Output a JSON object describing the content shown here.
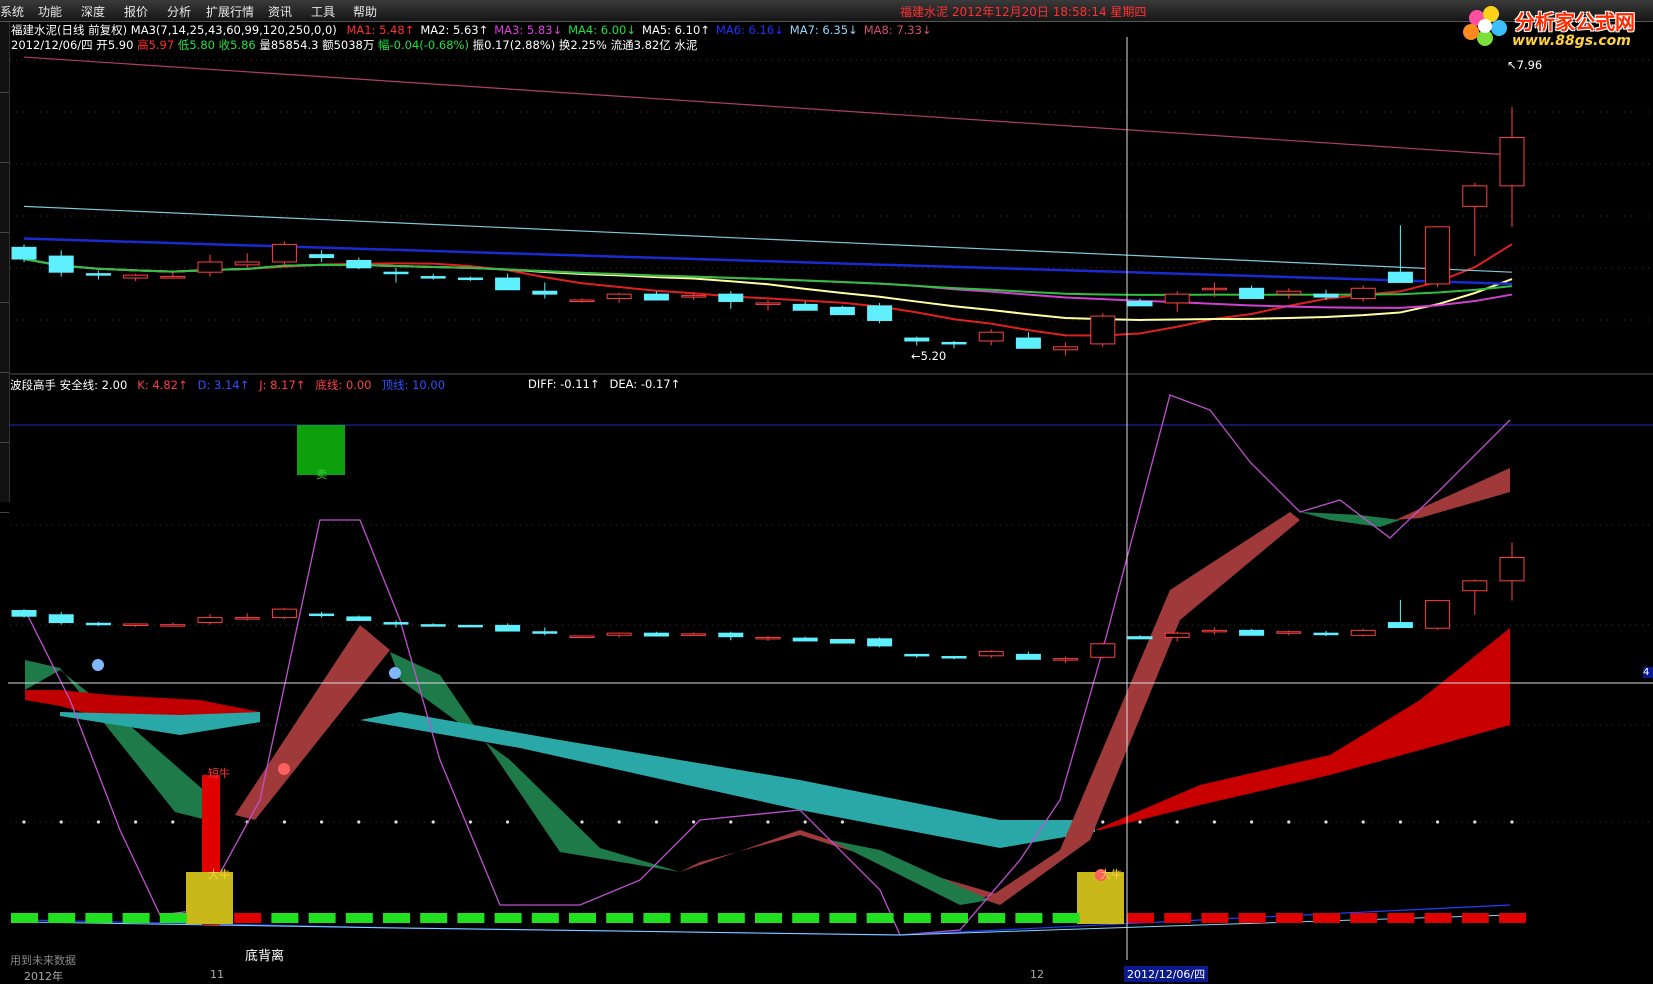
{
  "menu": [
    "系统",
    "功能",
    "深度",
    "报价",
    "分析",
    "扩展行情",
    "资讯",
    "工具",
    "帮助"
  ],
  "window_title": "福建水泥  2012年12月20日  18:58:14  星期四",
  "logo": {
    "title": "分析家公式网",
    "url": "www.88gs.com"
  },
  "header": {
    "stock": "福建水泥(日线 前复权)",
    "ma_params": "MA3(7,14,25,43,60,99,120,250,0,0)",
    "ma": [
      {
        "label": "MA1:",
        "value": "5.48",
        "arrow": "↑",
        "color": "#ff3030"
      },
      {
        "label": "MA2:",
        "value": "5.63",
        "arrow": "↑",
        "color": "#ffffff"
      },
      {
        "label": "MA3:",
        "value": "5.83",
        "arrow": "↓",
        "color": "#e040e0"
      },
      {
        "label": "MA4:",
        "value": "6.00",
        "arrow": "↓",
        "color": "#20e040"
      },
      {
        "label": "MA5:",
        "value": "6.10",
        "arrow": "↑",
        "color": "#ffffff"
      },
      {
        "label": "MA6:",
        "value": "6.16",
        "arrow": "↓",
        "color": "#2030ff"
      },
      {
        "label": "MA7:",
        "value": "6.35",
        "arrow": "↓",
        "color": "#8fd8ff"
      },
      {
        "label": "MA8:",
        "value": "7.33",
        "arrow": "↓",
        "color": "#d05070"
      }
    ],
    "bar_info": [
      {
        "t": "2012/12/06/四 开",
        "c": "#ffffff"
      },
      {
        "t": "5.90 ",
        "c": "#ffffff"
      },
      {
        "t": "高",
        "c": "#ff3030"
      },
      {
        "t": "5.97 ",
        "c": "#ff3030"
      },
      {
        "t": "低",
        "c": "#20e040"
      },
      {
        "t": "5.80 ",
        "c": "#20e040"
      },
      {
        "t": "收",
        "c": "#20e040"
      },
      {
        "t": "5.86 ",
        "c": "#20e040"
      },
      {
        "t": "量",
        "c": "#ffffff"
      },
      {
        "t": "85854.3 ",
        "c": "#ffffff"
      },
      {
        "t": "额",
        "c": "#ffffff"
      },
      {
        "t": "5038万 ",
        "c": "#ffffff"
      },
      {
        "t": "幅",
        "c": "#20e040"
      },
      {
        "t": "-0.04(-0.68%) ",
        "c": "#20e040"
      },
      {
        "t": "振",
        "c": "#ffffff"
      },
      {
        "t": "0.17(2.88%) ",
        "c": "#ffffff"
      },
      {
        "t": "换",
        "c": "#ffffff"
      },
      {
        "t": "2.25% ",
        "c": "#ffffff"
      },
      {
        "t": "流通",
        "c": "#ffffff"
      },
      {
        "t": "3.82亿 ",
        "c": "#ffffff"
      },
      {
        "t": "水泥",
        "c": "#ffffff"
      }
    ]
  },
  "indicator_header": [
    {
      "t": "波段高手  安全线: 2.00",
      "c": "#ffffff"
    },
    {
      "t": "K: 4.82↑",
      "c": "#ff4040"
    },
    {
      "t": "D: 3.14↑",
      "c": "#3050ff"
    },
    {
      "t": "J: 8.17↑",
      "c": "#ff4040"
    },
    {
      "t": "底线: 0.00",
      "c": "#ff4040"
    },
    {
      "t": "顶线: 10.00",
      "c": "#3050ff"
    }
  ],
  "macd_header": [
    {
      "t": "DIFF: -0.11↑",
      "c": "#ffffff"
    },
    {
      "t": "DEA: -0.17↑",
      "c": "#ffffff"
    }
  ],
  "price_labels": {
    "high": "7.96",
    "low": "5.20"
  },
  "signals": {
    "sell": "卖",
    "buy": "短牛",
    "bull1": "大牛",
    "bull2": "大牛"
  },
  "bottom_label": "底背离",
  "footer_note": "用到未来数据",
  "x_axis": [
    {
      "label": "2012年",
      "pos": "l1"
    },
    {
      "label": "11",
      "pos": "l2"
    },
    {
      "label": "12",
      "pos": "l3"
    }
  ],
  "cursor_date": "2012/12/06/四",
  "right_tag": "4",
  "colors": {
    "up": "#ff4040",
    "down": "#5ff0ff",
    "ma1": "#e02020",
    "ma2": "#ffffa0",
    "ma3": "#d040d0",
    "ma4": "#30c040",
    "ma6": "#1a2ad0",
    "ma7": "#80c8d8",
    "ma8": "#b04060"
  },
  "chart_data": {
    "type": "candlestick",
    "ohlc": [
      [
        5.72,
        5.74,
        5.62,
        5.64
      ],
      [
        5.66,
        5.7,
        5.52,
        5.55
      ],
      [
        5.54,
        5.56,
        5.5,
        5.53
      ],
      [
        5.51,
        5.54,
        5.49,
        5.53
      ],
      [
        5.52,
        5.55,
        5.51,
        5.52
      ],
      [
        5.55,
        5.67,
        5.52,
        5.62
      ],
      [
        5.6,
        5.68,
        5.58,
        5.62
      ],
      [
        5.62,
        5.76,
        5.6,
        5.74
      ],
      [
        5.67,
        5.7,
        5.62,
        5.65
      ],
      [
        5.63,
        5.65,
        5.57,
        5.58
      ],
      [
        5.55,
        5.58,
        5.48,
        5.54
      ],
      [
        5.52,
        5.54,
        5.5,
        5.51
      ],
      [
        5.51,
        5.52,
        5.49,
        5.5
      ],
      [
        5.51,
        5.54,
        5.45,
        5.43
      ],
      [
        5.42,
        5.48,
        5.37,
        5.4
      ],
      [
        5.35,
        5.37,
        5.34,
        5.36
      ],
      [
        5.37,
        5.41,
        5.34,
        5.4
      ],
      [
        5.4,
        5.42,
        5.37,
        5.36
      ],
      [
        5.38,
        5.41,
        5.36,
        5.39
      ],
      [
        5.4,
        5.42,
        5.3,
        5.35
      ],
      [
        5.34,
        5.36,
        5.29,
        5.34
      ],
      [
        5.33,
        5.35,
        5.3,
        5.29
      ],
      [
        5.31,
        5.32,
        5.27,
        5.26
      ],
      [
        5.32,
        5.34,
        5.2,
        5.22
      ],
      [
        5.1,
        5.11,
        5.05,
        5.08
      ],
      [
        5.07,
        5.08,
        5.03,
        5.06
      ],
      [
        5.08,
        5.16,
        5.05,
        5.14
      ],
      [
        5.1,
        5.14,
        5.05,
        5.03
      ],
      [
        5.02,
        5.07,
        4.98,
        5.04
      ],
      [
        5.06,
        5.27,
        5.04,
        5.25
      ],
      [
        5.35,
        5.37,
        5.33,
        5.32
      ],
      [
        5.34,
        5.42,
        5.28,
        5.4
      ],
      [
        5.43,
        5.48,
        5.38,
        5.44
      ],
      [
        5.44,
        5.46,
        5.4,
        5.37
      ],
      [
        5.4,
        5.44,
        5.37,
        5.42
      ],
      [
        5.4,
        5.43,
        5.36,
        5.38
      ],
      [
        5.37,
        5.46,
        5.35,
        5.44
      ],
      [
        5.55,
        5.87,
        5.5,
        5.48
      ],
      [
        5.47,
        5.86,
        5.45,
        5.86
      ],
      [
        6.0,
        6.16,
        5.66,
        6.14
      ],
      [
        6.14,
        6.68,
        5.86,
        6.47
      ]
    ]
  }
}
